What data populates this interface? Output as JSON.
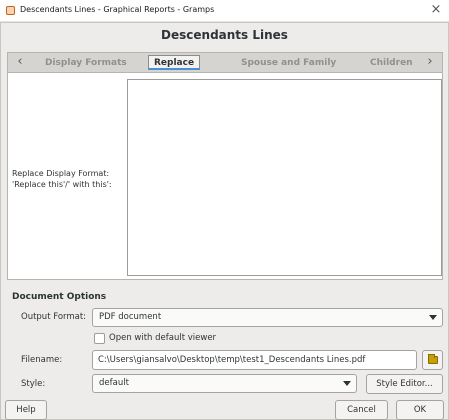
{
  "window": {
    "title": "Descendants Lines - Graphical Reports - Gramps",
    "app_icon": "gramps-icon",
    "close_glyph": "×"
  },
  "dialog": {
    "heading": "Descendants Lines"
  },
  "tabs": {
    "left_arrow": "‹",
    "right_arrow": "›",
    "items": [
      {
        "label": "Display Formats",
        "active": false
      },
      {
        "label": "Replace",
        "active": true
      },
      {
        "label": "Spouse and Family",
        "active": false
      },
      {
        "label": "Children",
        "active": false
      }
    ]
  },
  "replace_panel": {
    "label_line1": "Replace Display Format:",
    "label_line2": "'Replace this'/' with this':",
    "value": ""
  },
  "document_options": {
    "header": "Document Options",
    "output_format_label": "Output Format:",
    "output_format_value": "PDF document",
    "open_viewer_label": "Open with default viewer",
    "open_viewer_checked": false,
    "filename_label": "Filename:",
    "filename_value": "C:\\Users\\giansalvo\\Desktop\\temp\\test1_Descendants Lines.pdf",
    "style_label": "Style:",
    "style_value": "default",
    "style_editor_label": "Style Editor..."
  },
  "footer": {
    "help_label": "Help",
    "cancel_label": "Cancel",
    "ok_label": "OK"
  },
  "colors": {
    "frame_bg": "#edecea",
    "active_tab_underline": "#4a90d9",
    "folder_icon": "#c4a000"
  }
}
